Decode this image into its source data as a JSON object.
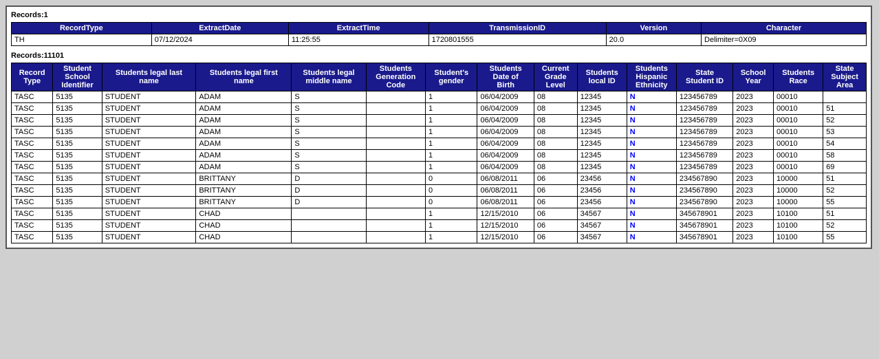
{
  "summary1": {
    "label": "Records:1"
  },
  "summary2": {
    "label": "Records:11101"
  },
  "headerTable": {
    "columns": [
      "RecordType",
      "ExtractDate",
      "ExtractTime",
      "TransmissionID",
      "Version",
      "Character"
    ],
    "row": [
      "TH",
      "07/12/2024",
      "11:25:55",
      "1720801555",
      "20.0",
      "Delimiter=0X09"
    ]
  },
  "dataTable": {
    "columns": [
      "Record\nType",
      "Student\nSchool\nIdentifier",
      "Students legal last\nname",
      "Students legal first\nname",
      "Students legal\nmiddle name",
      "Students\nGeneration\nCode",
      "Student's\ngender",
      "Students\nDate of\nBirth",
      "Current\nGrade\nLevel",
      "Students\nlocal ID",
      "Students\nHispanic\nEthnicity",
      "State\nStudent ID",
      "School\nYear",
      "Students\nRace",
      "State\nSubject\nArea"
    ],
    "columnLabels": [
      "Record Type",
      "Student School Identifier",
      "Students legal last name",
      "Students legal first name",
      "Students legal middle name",
      "Students Generation Code",
      "Student's gender",
      "Students Date of Birth",
      "Current Grade Level",
      "Students local ID",
      "Students Hispanic Ethnicity",
      "State Student ID",
      "School Year",
      "Students Race",
      "State Subject Area"
    ],
    "rows": [
      [
        "TASC",
        "5135",
        "STUDENT",
        "ADAM",
        "S",
        "",
        "1",
        "06/04/2009",
        "08",
        "12345",
        "N",
        "123456789",
        "2023",
        "00010",
        ""
      ],
      [
        "TASC",
        "5135",
        "STUDENT",
        "ADAM",
        "S",
        "",
        "1",
        "06/04/2009",
        "08",
        "12345",
        "N",
        "123456789",
        "2023",
        "00010",
        "51"
      ],
      [
        "TASC",
        "5135",
        "STUDENT",
        "ADAM",
        "S",
        "",
        "1",
        "06/04/2009",
        "08",
        "12345",
        "N",
        "123456789",
        "2023",
        "00010",
        "52"
      ],
      [
        "TASC",
        "5135",
        "STUDENT",
        "ADAM",
        "S",
        "",
        "1",
        "06/04/2009",
        "08",
        "12345",
        "N",
        "123456789",
        "2023",
        "00010",
        "53"
      ],
      [
        "TASC",
        "5135",
        "STUDENT",
        "ADAM",
        "S",
        "",
        "1",
        "06/04/2009",
        "08",
        "12345",
        "N",
        "123456789",
        "2023",
        "00010",
        "54"
      ],
      [
        "TASC",
        "5135",
        "STUDENT",
        "ADAM",
        "S",
        "",
        "1",
        "06/04/2009",
        "08",
        "12345",
        "N",
        "123456789",
        "2023",
        "00010",
        "58"
      ],
      [
        "TASC",
        "5135",
        "STUDENT",
        "ADAM",
        "S",
        "",
        "1",
        "06/04/2009",
        "08",
        "12345",
        "N",
        "123456789",
        "2023",
        "00010",
        "69"
      ],
      [
        "TASC",
        "5135",
        "STUDENT",
        "BRITTANY",
        "D",
        "",
        "0",
        "06/08/2011",
        "06",
        "23456",
        "N",
        "234567890",
        "2023",
        "10000",
        "51"
      ],
      [
        "TASC",
        "5135",
        "STUDENT",
        "BRITTANY",
        "D",
        "",
        "0",
        "06/08/2011",
        "06",
        "23456",
        "N",
        "234567890",
        "2023",
        "10000",
        "52"
      ],
      [
        "TASC",
        "5135",
        "STUDENT",
        "BRITTANY",
        "D",
        "",
        "0",
        "06/08/2011",
        "06",
        "23456",
        "N",
        "234567890",
        "2023",
        "10000",
        "55"
      ],
      [
        "TASC",
        "5135",
        "STUDENT",
        "CHAD",
        "",
        "",
        "1",
        "12/15/2010",
        "06",
        "34567",
        "N",
        "345678901",
        "2023",
        "10100",
        "51"
      ],
      [
        "TASC",
        "5135",
        "STUDENT",
        "CHAD",
        "",
        "",
        "1",
        "12/15/2010",
        "06",
        "34567",
        "N",
        "345678901",
        "2023",
        "10100",
        "52"
      ],
      [
        "TASC",
        "5135",
        "STUDENT",
        "CHAD",
        "",
        "",
        "1",
        "12/15/2010",
        "06",
        "34567",
        "N",
        "345678901",
        "2023",
        "10100",
        "55"
      ]
    ]
  }
}
